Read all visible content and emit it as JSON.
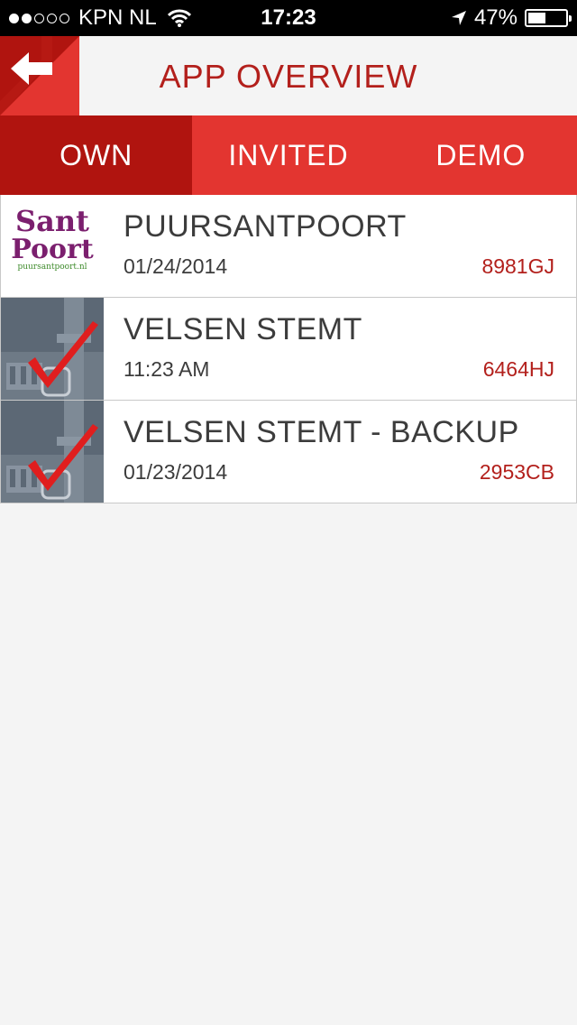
{
  "status": {
    "carrier": "KPN NL",
    "time": "17:23",
    "battery": "47%",
    "battery_level": 0.47,
    "signal_bars_filled": 2,
    "signal_bars_total": 5
  },
  "header": {
    "title": "APP OVERVIEW"
  },
  "tabs": [
    {
      "label": "OWN",
      "active": true
    },
    {
      "label": "INVITED",
      "active": false
    },
    {
      "label": "DEMO",
      "active": false
    }
  ],
  "apps": [
    {
      "name": "PUURSANTPOORT",
      "date": "01/24/2014",
      "code": "8981GJ",
      "thumb": "santpoort-logo",
      "logo_line1": "Sant",
      "logo_line2": "Poort",
      "logo_url": "puursantpoort.nl"
    },
    {
      "name": "VELSEN STEMT",
      "date": "11:23 AM",
      "code": "6464HJ",
      "thumb": "checkmark-tower"
    },
    {
      "name": "VELSEN STEMT - BACKUP",
      "date": "01/23/2014",
      "code": "2953CB",
      "thumb": "checkmark-tower"
    }
  ],
  "colors": {
    "accent_red": "#e33530",
    "dark_red": "#b0140f",
    "title_red": "#b3201c",
    "logo_purple": "#7b1f6e",
    "logo_green": "#3d8a2a"
  }
}
